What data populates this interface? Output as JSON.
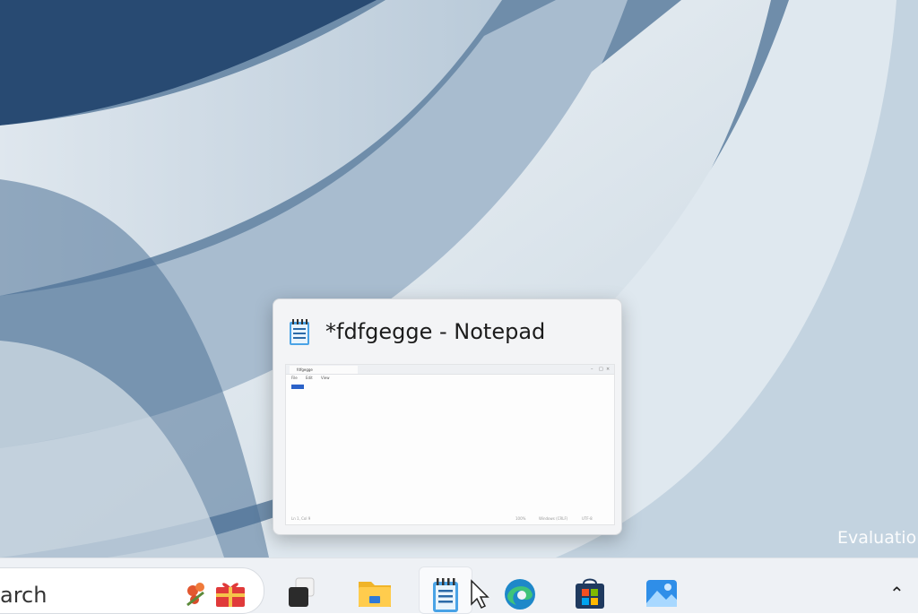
{
  "desktop": {
    "watermark": "Evaluation"
  },
  "thumbnail": {
    "title": "*fdfgegge - Notepad",
    "icon": "notepad-icon",
    "preview": {
      "tab": "fdfgegge",
      "menu": [
        "File",
        "Edit",
        "View"
      ],
      "status": [
        "Ln 1, Col 9",
        "100%",
        "Windows (CRLF)",
        "UTF-8"
      ]
    }
  },
  "taskbar": {
    "search_text": "arch",
    "widget_icon": "gift-icon",
    "apps": [
      {
        "name": "task-view",
        "icon": "task-view-icon"
      },
      {
        "name": "file-explorer",
        "icon": "folder-icon"
      },
      {
        "name": "notepad",
        "icon": "notepad-icon",
        "active": true
      },
      {
        "name": "edge",
        "icon": "edge-icon"
      },
      {
        "name": "microsoft-store",
        "icon": "store-icon"
      },
      {
        "name": "photos",
        "icon": "photos-icon"
      }
    ],
    "tray_chevron": "chevron-up-icon"
  },
  "colors": {
    "taskbar": "#eef1f5",
    "accent": "#2b62c8"
  }
}
